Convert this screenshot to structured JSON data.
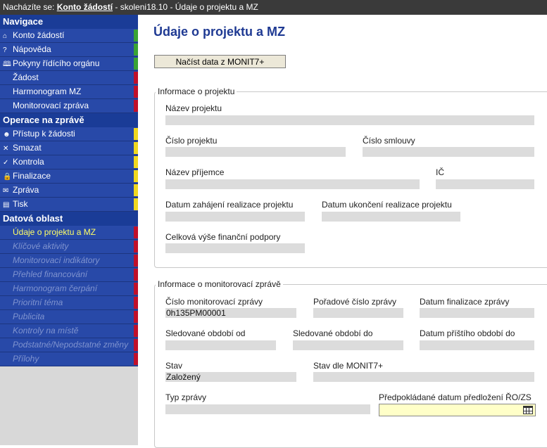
{
  "topbar": {
    "prefix": "Nacházíte se:",
    "crumb_link": "Konto žádostí",
    "rest": "- skoleni18.10 - Údaje o projektu a MZ"
  },
  "sidebar": {
    "sections": [
      {
        "title": "Navigace",
        "items": [
          {
            "label": "Konto žádostí",
            "icon": "home-icon",
            "glyph": "⌂",
            "marker": "#3aa335"
          },
          {
            "label": "Nápověda",
            "icon": "help-icon",
            "glyph": "?",
            "marker": "#3aa335"
          },
          {
            "label": "Pokyny řídícího orgánu",
            "icon": "book-icon",
            "glyph": "🕮",
            "marker": "#3aa335"
          },
          {
            "label": "Žádost",
            "icon": "",
            "glyph": "",
            "marker": "#c0102a"
          },
          {
            "label": "Harmonogram MZ",
            "icon": "",
            "glyph": "",
            "marker": "#c0102a"
          },
          {
            "label": "Monitorovací zpráva",
            "icon": "",
            "glyph": "",
            "marker": "#c0102a"
          }
        ]
      },
      {
        "title": "Operace na zprávě",
        "items": [
          {
            "label": "Přístup k žádosti",
            "icon": "user-icon",
            "glyph": "☻",
            "marker": "#f0d820"
          },
          {
            "label": "Smazat",
            "icon": "delete-icon",
            "glyph": "✕",
            "marker": "#f0d820"
          },
          {
            "label": "Kontrola",
            "icon": "check-icon",
            "glyph": "✓",
            "marker": "#f0d820"
          },
          {
            "label": "Finalizace",
            "icon": "lock-icon",
            "glyph": "🔒",
            "marker": "#f0d820"
          },
          {
            "label": "Zpráva",
            "icon": "mail-icon",
            "glyph": "✉",
            "marker": "#f0d820"
          },
          {
            "label": "Tisk",
            "icon": "print-icon",
            "glyph": "▤",
            "marker": "#f0d820"
          }
        ]
      },
      {
        "title": "Datová oblast",
        "items": [
          {
            "label": "Údaje o projektu a MZ",
            "icon": "",
            "glyph": "",
            "marker": "#c0102a",
            "state": "active"
          },
          {
            "label": "Klíčové aktivity",
            "icon": "",
            "glyph": "",
            "marker": "#c0102a",
            "state": "disabled"
          },
          {
            "label": "Monitorovací indikátory",
            "icon": "",
            "glyph": "",
            "marker": "#c0102a",
            "state": "disabled"
          },
          {
            "label": "Přehled financování",
            "icon": "",
            "glyph": "",
            "marker": "#c0102a",
            "state": "disabled"
          },
          {
            "label": "Harmonogram čerpání",
            "icon": "",
            "glyph": "",
            "marker": "#c0102a",
            "state": "disabled"
          },
          {
            "label": "Prioritní téma",
            "icon": "",
            "glyph": "",
            "marker": "#c0102a",
            "state": "disabled"
          },
          {
            "label": "Publicita",
            "icon": "",
            "glyph": "",
            "marker": "#c0102a",
            "state": "disabled"
          },
          {
            "label": "Kontroly na místě",
            "icon": "",
            "glyph": "",
            "marker": "#c0102a",
            "state": "disabled"
          },
          {
            "label": "Podstatné/Nepodstatné změny",
            "icon": "",
            "glyph": "",
            "marker": "#c0102a",
            "state": "disabled"
          },
          {
            "label": "Přílohy",
            "icon": "",
            "glyph": "",
            "marker": "#c0102a",
            "state": "disabled"
          }
        ]
      }
    ]
  },
  "main": {
    "title": "Údaje o projektu a MZ",
    "load_button": "Načíst data z MONIT7+",
    "project": {
      "legend": "Informace o projektu",
      "nazev_projektu_label": "Název projektu",
      "nazev_projektu_value": "",
      "cislo_projektu_label": "Číslo projektu",
      "cislo_projektu_value": "",
      "cislo_smlouvy_label": "Číslo smlouvy",
      "cislo_smlouvy_value": "",
      "nazev_prijemce_label": "Název příjemce",
      "nazev_prijemce_value": "",
      "ic_label": "IČ",
      "ic_value": "",
      "datum_zahajeni_label": "Datum zahájení realizace projektu",
      "datum_zahajeni_value": "",
      "datum_ukonceni_label": "Datum ukončení realizace projektu",
      "datum_ukonceni_value": "",
      "celkova_vyse_label": "Celková výše finanční podpory",
      "celkova_vyse_value": ""
    },
    "report": {
      "legend": "Informace o monitorovací zprávě",
      "cislo_mz_label": "Číslo monitorovací zprávy",
      "cislo_mz_value": "0h135PM00001",
      "poradove_cislo_label": "Pořadové číslo zprávy",
      "poradove_cislo_value": "",
      "datum_finalizace_label": "Datum finalizace zprávy",
      "datum_finalizace_value": "",
      "obdobi_od_label": "Sledované období od",
      "obdobi_od_value": "",
      "obdobi_do_label": "Sledované období do",
      "obdobi_do_value": "",
      "pristi_obdobi_label": "Datum příštího období do",
      "pristi_obdobi_value": "",
      "stav_label": "Stav",
      "stav_value": "Založený",
      "stav_monit_label": "Stav dle MONIT7+",
      "stav_monit_value": "",
      "typ_zpravy_label": "Typ zprávy",
      "typ_zpravy_value": "",
      "predpokladane_datum_label": "Předpokládané datum předložení ŘO/ZS",
      "predpokladane_datum_value": "",
      "calendar_icon": "calendar-icon"
    }
  }
}
